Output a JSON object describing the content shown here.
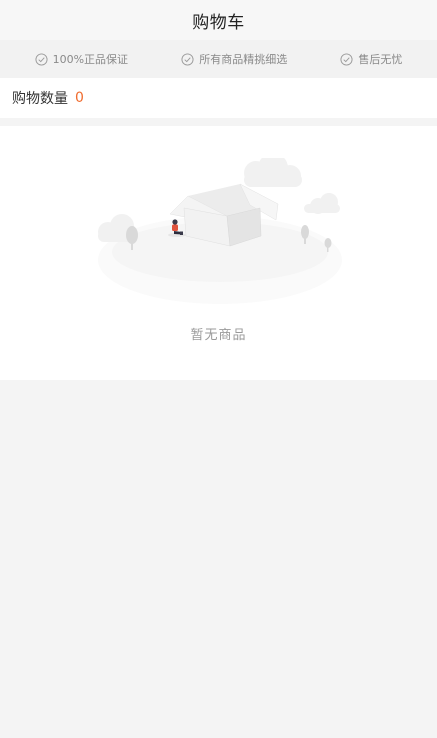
{
  "header": {
    "title": "购物车"
  },
  "guarantees": [
    {
      "label": "100%正品保证",
      "icon": "check-circle-icon"
    },
    {
      "label": "所有商品精挑细选",
      "icon": "check-circle-icon"
    },
    {
      "label": "售后无忧",
      "icon": "check-circle-icon"
    }
  ],
  "cart": {
    "count_label": "购物数量",
    "count_value": "0"
  },
  "empty": {
    "text": "暂无商品",
    "illustration": "empty-box-illustration"
  },
  "colors": {
    "accent": "#f06c2f",
    "background": "#f4f4f4",
    "muted_text": "#9a9a9a"
  }
}
